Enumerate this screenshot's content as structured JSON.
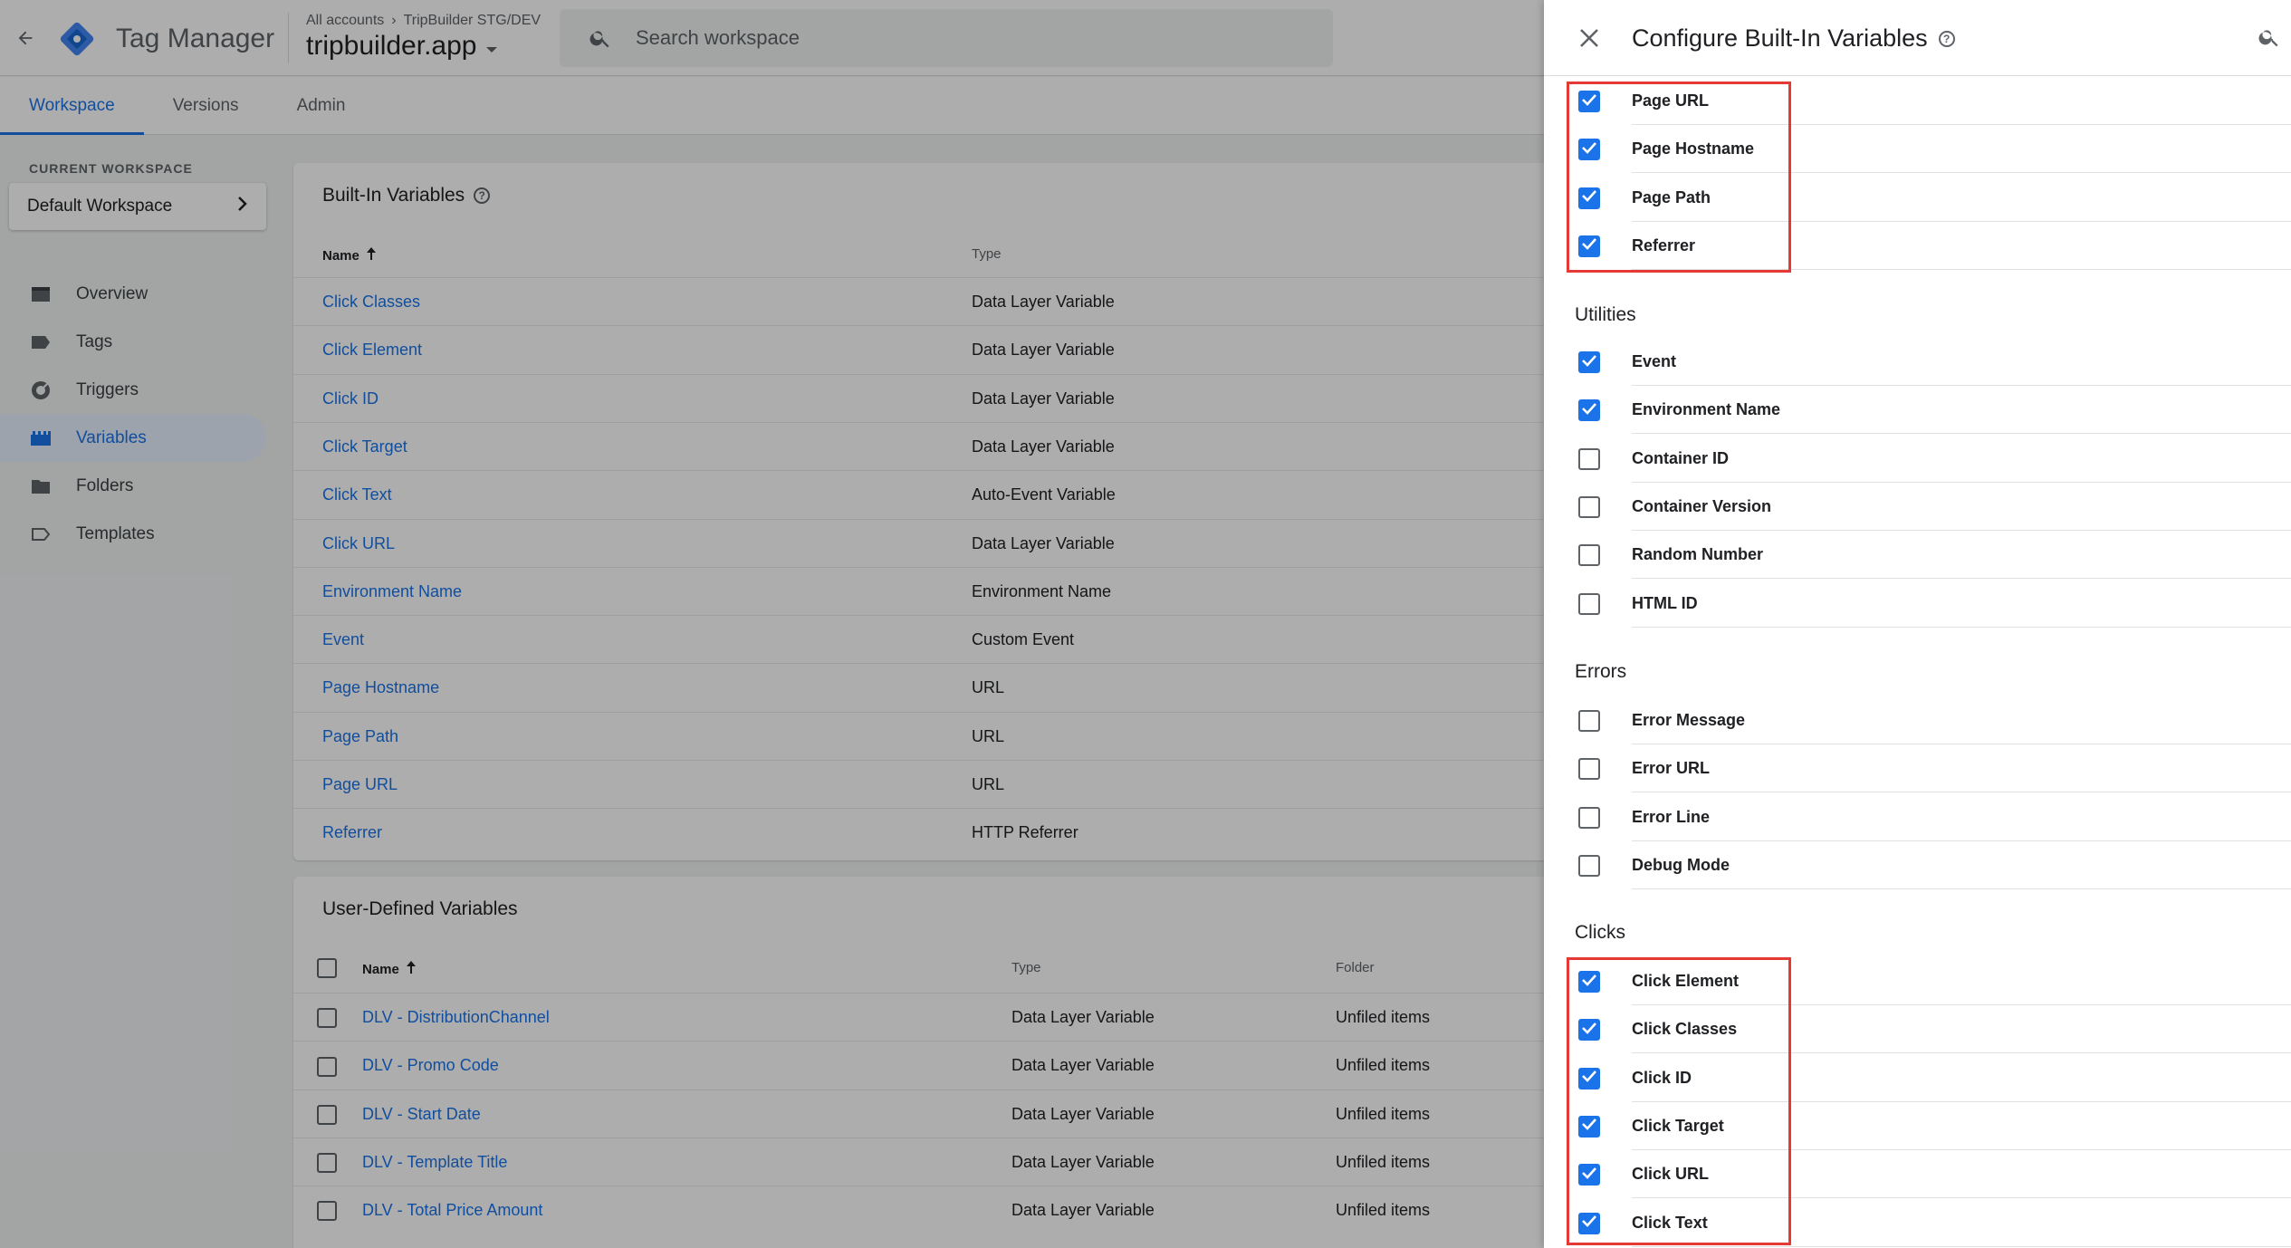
{
  "app": {
    "product_name": "Tag Manager",
    "accounts_crumb": "All accounts",
    "account_name": "TripBuilder STG/DEV",
    "container_name": "tripbuilder.app",
    "search_placeholder": "Search workspace"
  },
  "nav_tabs": [
    {
      "label": "Workspace",
      "active": true
    },
    {
      "label": "Versions",
      "active": false
    },
    {
      "label": "Admin",
      "active": false
    }
  ],
  "sidebar": {
    "workspace_label": "CURRENT WORKSPACE",
    "workspace_name": "Default Workspace",
    "items": [
      {
        "label": "Overview",
        "icon": "overview-icon",
        "active": false
      },
      {
        "label": "Tags",
        "icon": "tag-icon",
        "active": false
      },
      {
        "label": "Triggers",
        "icon": "trigger-icon",
        "active": false
      },
      {
        "label": "Variables",
        "icon": "variables-icon",
        "active": true
      },
      {
        "label": "Folders",
        "icon": "folder-icon",
        "active": false
      },
      {
        "label": "Templates",
        "icon": "template-icon",
        "active": false
      }
    ]
  },
  "builtin_card": {
    "title": "Built-In Variables",
    "col_name": "Name",
    "col_type": "Type",
    "rows": [
      {
        "name": "Click Classes",
        "type": "Data Layer Variable"
      },
      {
        "name": "Click Element",
        "type": "Data Layer Variable"
      },
      {
        "name": "Click ID",
        "type": "Data Layer Variable"
      },
      {
        "name": "Click Target",
        "type": "Data Layer Variable"
      },
      {
        "name": "Click Text",
        "type": "Auto-Event Variable"
      },
      {
        "name": "Click URL",
        "type": "Data Layer Variable"
      },
      {
        "name": "Environment Name",
        "type": "Environment Name"
      },
      {
        "name": "Event",
        "type": "Custom Event"
      },
      {
        "name": "Page Hostname",
        "type": "URL"
      },
      {
        "name": "Page Path",
        "type": "URL"
      },
      {
        "name": "Page URL",
        "type": "URL"
      },
      {
        "name": "Referrer",
        "type": "HTTP Referrer"
      }
    ]
  },
  "user_card": {
    "title": "User-Defined Variables",
    "col_name": "Name",
    "col_type": "Type",
    "col_folder": "Folder",
    "rows": [
      {
        "name": "DLV - DistributionChannel",
        "type": "Data Layer Variable",
        "folder": "Unfiled items"
      },
      {
        "name": "DLV - Promo Code",
        "type": "Data Layer Variable",
        "folder": "Unfiled items"
      },
      {
        "name": "DLV - Start Date",
        "type": "Data Layer Variable",
        "folder": "Unfiled items"
      },
      {
        "name": "DLV - Template Title",
        "type": "Data Layer Variable",
        "folder": "Unfiled items"
      },
      {
        "name": "DLV - Total Price Amount",
        "type": "Data Layer Variable",
        "folder": "Unfiled items"
      }
    ]
  },
  "panel": {
    "title": "Configure Built-In Variables",
    "page_rows": [
      {
        "label": "Page URL",
        "checked": true
      },
      {
        "label": "Page Hostname",
        "checked": true
      },
      {
        "label": "Page Path",
        "checked": true
      },
      {
        "label": "Referrer",
        "checked": true
      }
    ],
    "utilities_title": "Utilities",
    "utilities_rows": [
      {
        "label": "Event",
        "checked": true
      },
      {
        "label": "Environment Name",
        "checked": true
      },
      {
        "label": "Container ID",
        "checked": false
      },
      {
        "label": "Container Version",
        "checked": false
      },
      {
        "label": "Random Number",
        "checked": false
      },
      {
        "label": "HTML ID",
        "checked": false
      }
    ],
    "errors_title": "Errors",
    "errors_rows": [
      {
        "label": "Error Message",
        "checked": false
      },
      {
        "label": "Error URL",
        "checked": false
      },
      {
        "label": "Error Line",
        "checked": false
      },
      {
        "label": "Debug Mode",
        "checked": false
      }
    ],
    "clicks_title": "Clicks",
    "clicks_rows": [
      {
        "label": "Click Element",
        "checked": true
      },
      {
        "label": "Click Classes",
        "checked": true
      },
      {
        "label": "Click ID",
        "checked": true
      },
      {
        "label": "Click Target",
        "checked": true
      },
      {
        "label": "Click URL",
        "checked": true
      },
      {
        "label": "Click Text",
        "checked": true
      }
    ]
  },
  "colors": {
    "accent": "#1a73e8",
    "highlight_box": "#e53935",
    "logo_blue": "#4285f4",
    "logo_dark": "#1967d2"
  }
}
